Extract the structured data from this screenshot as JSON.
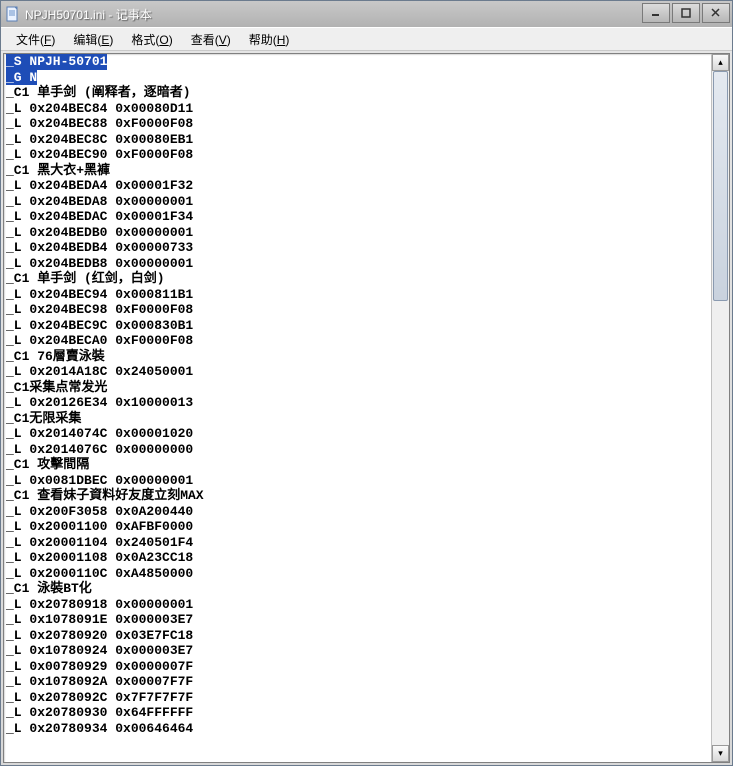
{
  "window": {
    "title": "NPJH50701.ini - 记事本"
  },
  "menu": {
    "file": "文件(",
    "file_h": "F",
    "file_tail": ")",
    "edit": "编辑(",
    "edit_h": "E",
    "edit_tail": ")",
    "format": "格式(",
    "format_h": "O",
    "format_tail": ")",
    "view": "查看(",
    "view_h": "V",
    "view_tail": ")",
    "help": "帮助(",
    "help_h": "H",
    "help_tail": ")"
  },
  "scroll": {
    "up": "▴",
    "down": "▾"
  },
  "lines": [
    "_S NPJH-50701",
    "_G N",
    "_C1 单手剑 (阐释者，逐暗者)",
    "_L 0x204BEC84 0x00080D11",
    "_L 0x204BEC88 0xF0000F08",
    "_L 0x204BEC8C 0x00080EB1",
    "_L 0x204BEC90 0xF0000F08",
    "_C1 黑大衣+黑褲",
    "_L 0x204BEDA4 0x00001F32",
    "_L 0x204BEDA8 0x00000001",
    "_L 0x204BEDAC 0x00001F34",
    "_L 0x204BEDB0 0x00000001",
    "_L 0x204BEDB4 0x00000733",
    "_L 0x204BEDB8 0x00000001",
    "_C1 单手剑 (红剑，白剑)",
    "_L 0x204BEC94 0x000811B1",
    "_L 0x204BEC98 0xF0000F08",
    "_L 0x204BEC9C 0x000830B1",
    "_L 0x204BECA0 0xF0000F08",
    "_C1 76層賣泳裝",
    "_L 0x2014A18C 0x24050001",
    "_C1采集点常发光",
    "_L 0x20126E34 0x10000013",
    "_C1无限采集",
    "_L 0x2014074C 0x00001020",
    "_L 0x2014076C 0x00000000",
    "_C1 攻擊間隔",
    "_L 0x0081DBEC 0x00000001",
    "_C1 查看妹子資料好友度立刻MAX",
    "_L 0x200F3058 0x0A200440",
    "_L 0x20001100 0xAFBF0000",
    "_L 0x20001104 0x240501F4",
    "_L 0x20001108 0x0A23CC18",
    "_L 0x2000110C 0xA4850000",
    "_C1 泳裝BT化",
    "_L 0x20780918 0x00000001",
    "_L 0x1078091E 0x000003E7",
    "_L 0x20780920 0x03E7FC18",
    "_L 0x10780924 0x000003E7",
    "_L 0x00780929 0x0000007F",
    "_L 0x1078092A 0x00007F7F",
    "_L 0x2078092C 0x7F7F7F7F",
    "_L 0x20780930 0x64FFFFFF",
    "_L 0x20780934 0x00646464"
  ]
}
